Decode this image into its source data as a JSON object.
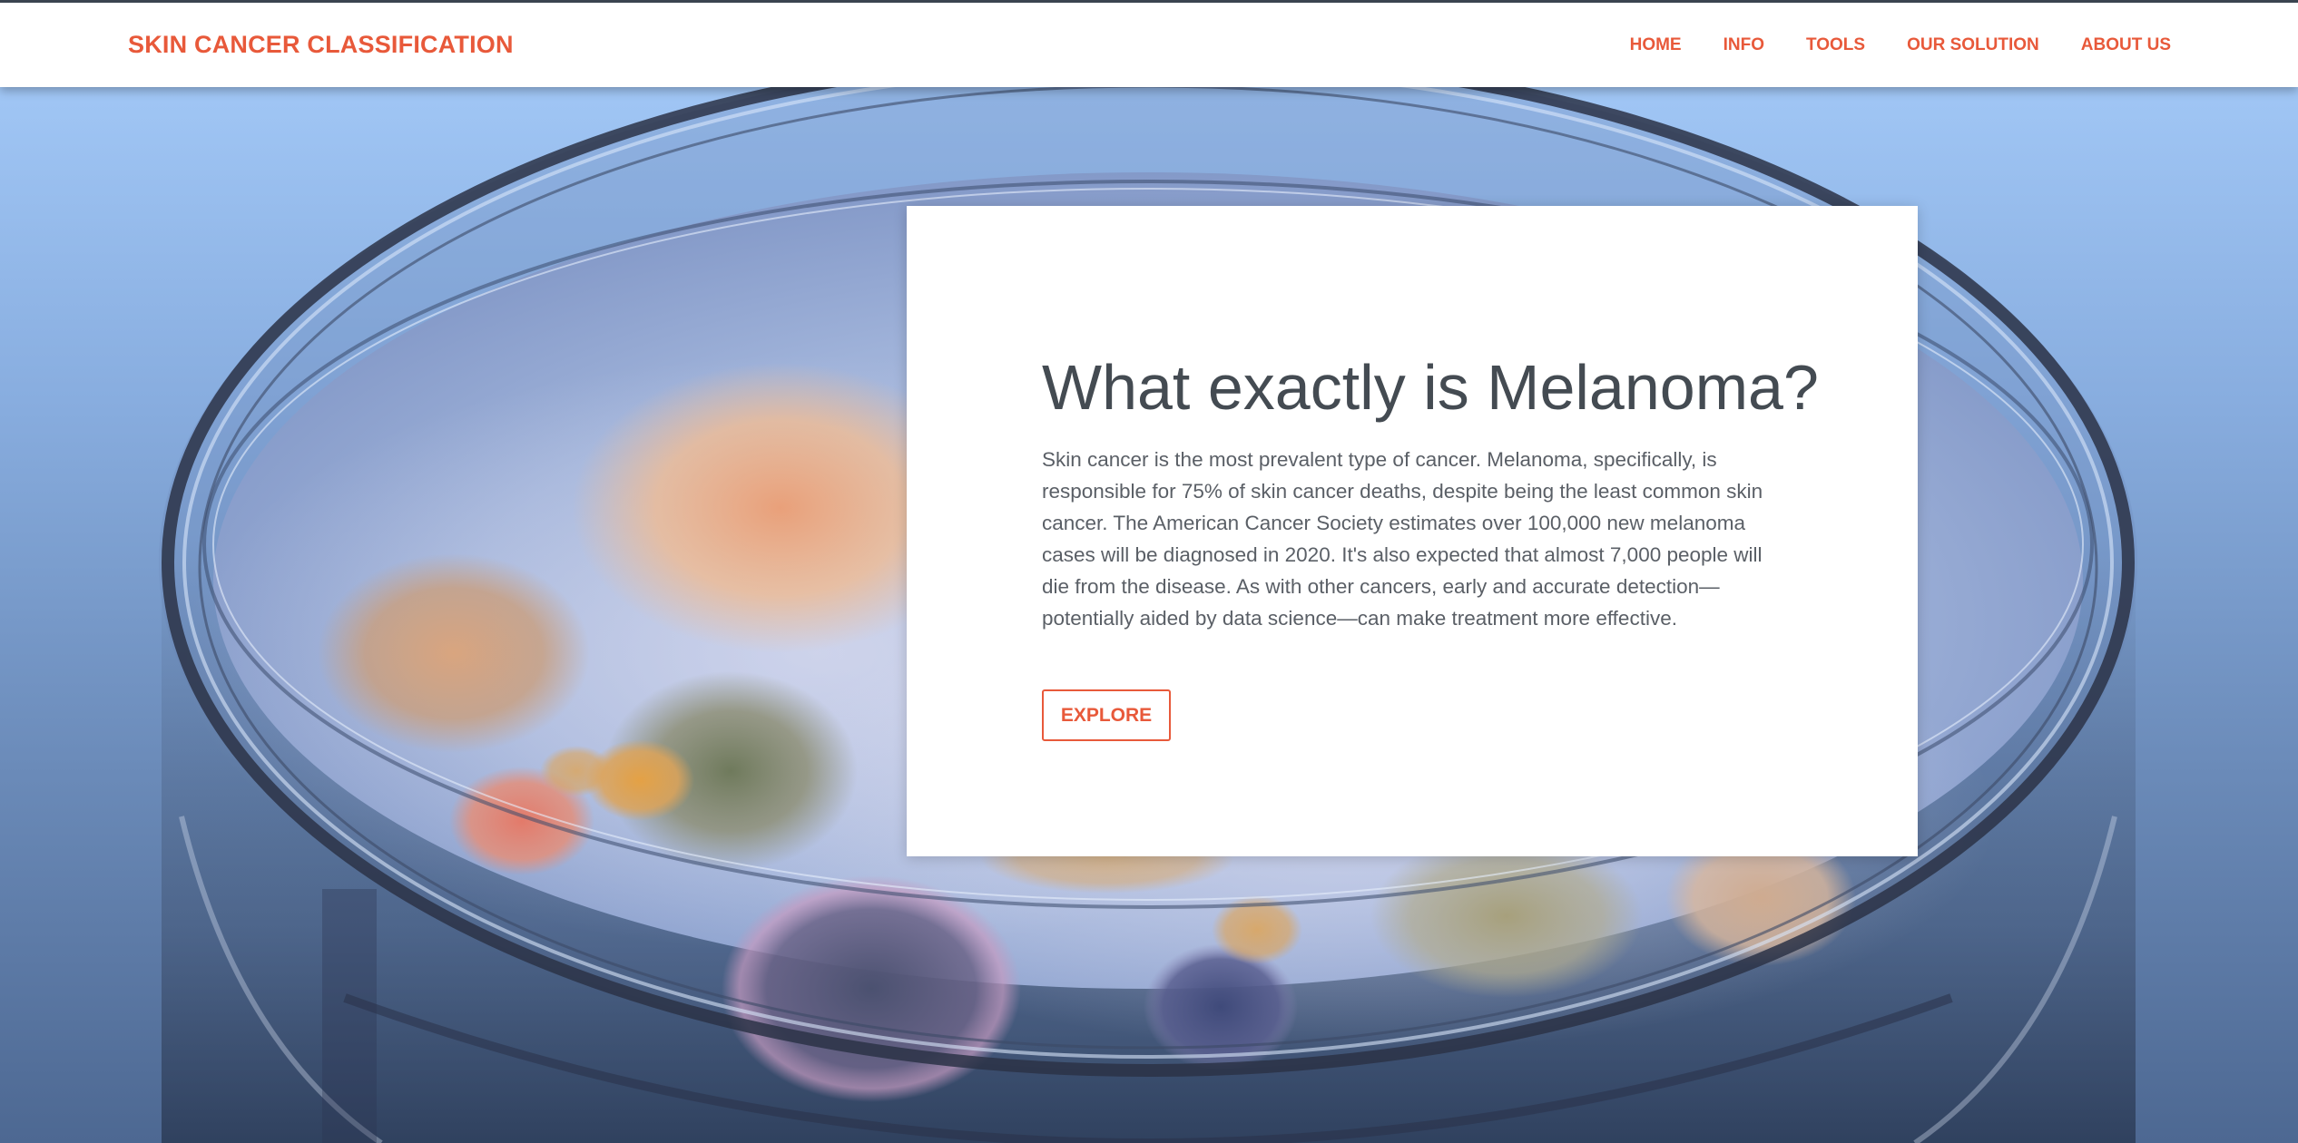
{
  "navbar": {
    "brand": "SKIN CANCER CLASSIFICATION",
    "links": [
      "HOME",
      "INFO",
      "TOOLS",
      "OUR SOLUTION",
      "ABOUT US"
    ]
  },
  "hero": {
    "image_alt": "Petri dish with bacterial colonies",
    "title": "What exactly is Melanoma?",
    "body": "Skin cancer is the most prevalent type of cancer. Melanoma, specifically, is responsible for 75% of skin cancer deaths, despite being the least common skin cancer. The American Cancer Society estimates over 100,000 new melanoma cases will be diagnosed in 2020. It's also expected that almost 7,000 people will die from the disease. As with other cancers, early and accurate detection—potentially aided by data science—can make treatment more effective.",
    "button_label": "EXPLORE"
  },
  "colors": {
    "accent": "#e8593a",
    "title_text": "#444b52",
    "body_text": "#5a5f66",
    "navbar_bg": "#ffffff"
  }
}
